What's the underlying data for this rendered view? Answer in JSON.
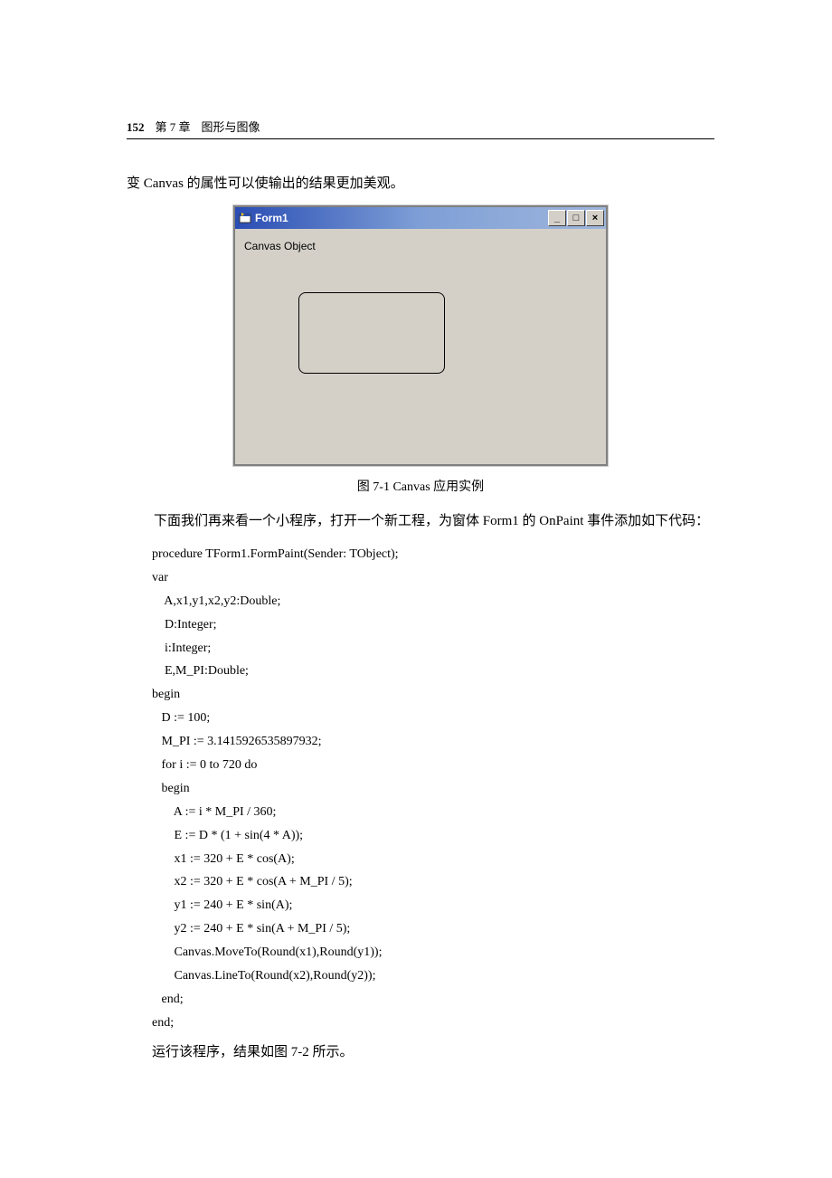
{
  "header": {
    "page_number": "152",
    "chapter": "第 7 章",
    "title": "图形与图像"
  },
  "intro_line": "变 Canvas 的属性可以使输出的结果更加美观。",
  "window": {
    "title": "Form1",
    "min_label": "_",
    "max_label": "□",
    "close_label": "×",
    "body_text": "Canvas Object"
  },
  "figure_caption": "图 7-1   Canvas 应用实例",
  "paragraph2": "下面我们再来看一个小程序，打开一个新工程，为窗体 Form1 的 OnPaint 事件添加如下代码：",
  "code": "procedure TForm1.FormPaint(Sender: TObject);\nvar\n    A,x1,y1,x2,y2:Double;\n    D:Integer;\n    i:Integer;\n    E,M_PI:Double;\nbegin\n   D := 100;\n   M_PI := 3.1415926535897932;\n   for i := 0 to 720 do\n   begin\n       A := i * M_PI / 360;\n       E := D * (1 + sin(4 * A));\n       x1 := 320 + E * cos(A);\n       x2 := 320 + E * cos(A + M_PI / 5);\n       y1 := 240 + E * sin(A);\n       y2 := 240 + E * sin(A + M_PI / 5);\n       Canvas.MoveTo(Round(x1),Round(y1));\n       Canvas.LineTo(Round(x2),Round(y2));\n   end;\nend;",
  "closing_line": "运行该程序，结果如图 7-2 所示。"
}
